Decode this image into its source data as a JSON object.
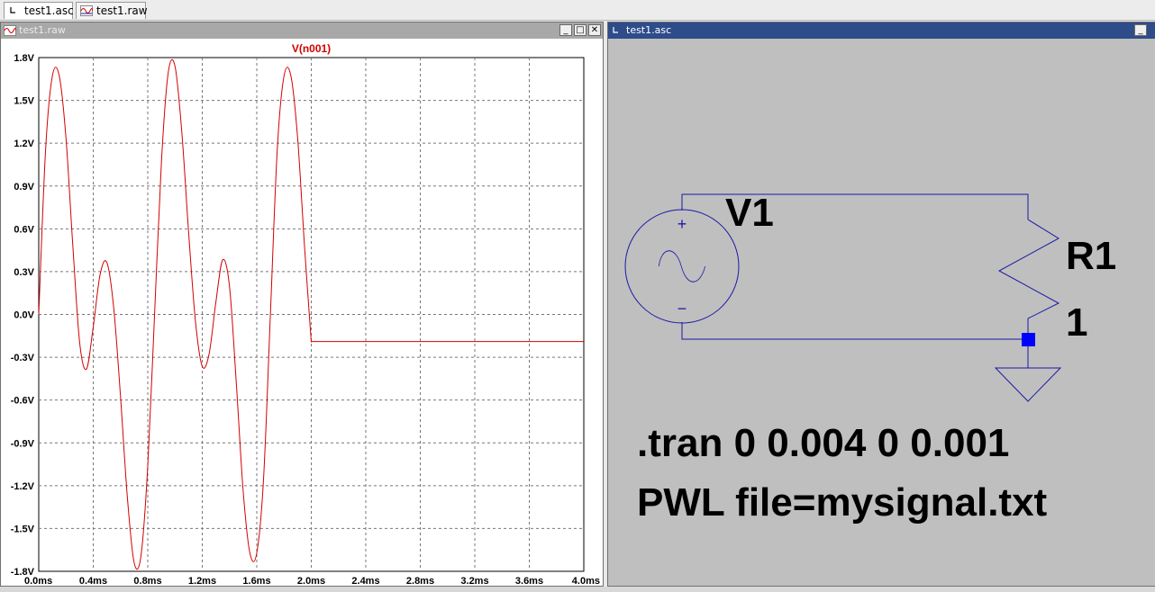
{
  "tabs": [
    {
      "label": "test1.asc",
      "icon": "schematic-icon"
    },
    {
      "label": "test1.raw",
      "icon": "waveform-icon"
    }
  ],
  "waveform_window": {
    "title": "test1.raw",
    "controls": [
      "minimize",
      "maximize",
      "close"
    ]
  },
  "schematic_window": {
    "title": "test1.asc",
    "controls": [
      "minimize"
    ]
  },
  "colors": {
    "trace": "#d40000",
    "wire": "#1a1aa6",
    "junction": "#0000ff",
    "active_title": "#2e4b8a"
  },
  "chart_data": {
    "type": "line",
    "title": "V(n001)",
    "xlabel": "",
    "ylabel": "",
    "xlim": [
      0,
      4.0
    ],
    "ylim": [
      -1.8,
      1.8
    ],
    "grid": true,
    "x_ticks": [
      "0.0ms",
      "0.4ms",
      "0.8ms",
      "1.2ms",
      "1.6ms",
      "2.0ms",
      "2.4ms",
      "2.8ms",
      "3.2ms",
      "3.6ms",
      "4.0ms"
    ],
    "y_ticks": [
      "1.8V",
      "1.5V",
      "1.2V",
      "0.9V",
      "0.6V",
      "0.3V",
      "0.0V",
      "-0.3V",
      "-0.6V",
      "-0.9V",
      "-1.2V",
      "-1.5V",
      "-1.8V"
    ],
    "series": [
      {
        "name": "V(n001)",
        "x": [
          0,
          0.05,
          0.1,
          0.15,
          0.2,
          0.25,
          0.3,
          0.35,
          0.4,
          0.45,
          0.5,
          0.55,
          0.6,
          0.65,
          0.7,
          0.75,
          0.8,
          0.85,
          0.9,
          0.95,
          1.0,
          1.05,
          1.1,
          1.15,
          1.2,
          1.25,
          1.3,
          1.35,
          1.4,
          1.45,
          1.5,
          1.55,
          1.6,
          1.65,
          1.7,
          1.75,
          1.8,
          1.85,
          1.9,
          1.95,
          2.0,
          2.0001,
          4.0
        ],
        "y": [
          0,
          1.149,
          1.671,
          1.674,
          1.235,
          0.483,
          -0.195,
          -0.383,
          -0.087,
          0.278,
          0.364,
          0.048,
          -0.574,
          -1.277,
          -1.739,
          -1.693,
          -1.062,
          0.0,
          1.062,
          1.693,
          1.739,
          1.277,
          0.574,
          -0.048,
          -0.364,
          -0.278,
          0.087,
          0.383,
          0.195,
          -0.483,
          -1.235,
          -1.674,
          -1.671,
          -1.149,
          0.0,
          1.149,
          1.671,
          1.674,
          1.235,
          0.483,
          -0.195,
          -0.19,
          -0.19
        ]
      }
    ]
  },
  "schematic": {
    "source_label": "V1",
    "resistor_label": "R1",
    "resistor_value": "1",
    "plus_sign": "+",
    "minus_sign": "−",
    "directive_tran": ".tran 0 0.004 0 0.001",
    "directive_pwl": "PWL file=mysignal.txt"
  }
}
